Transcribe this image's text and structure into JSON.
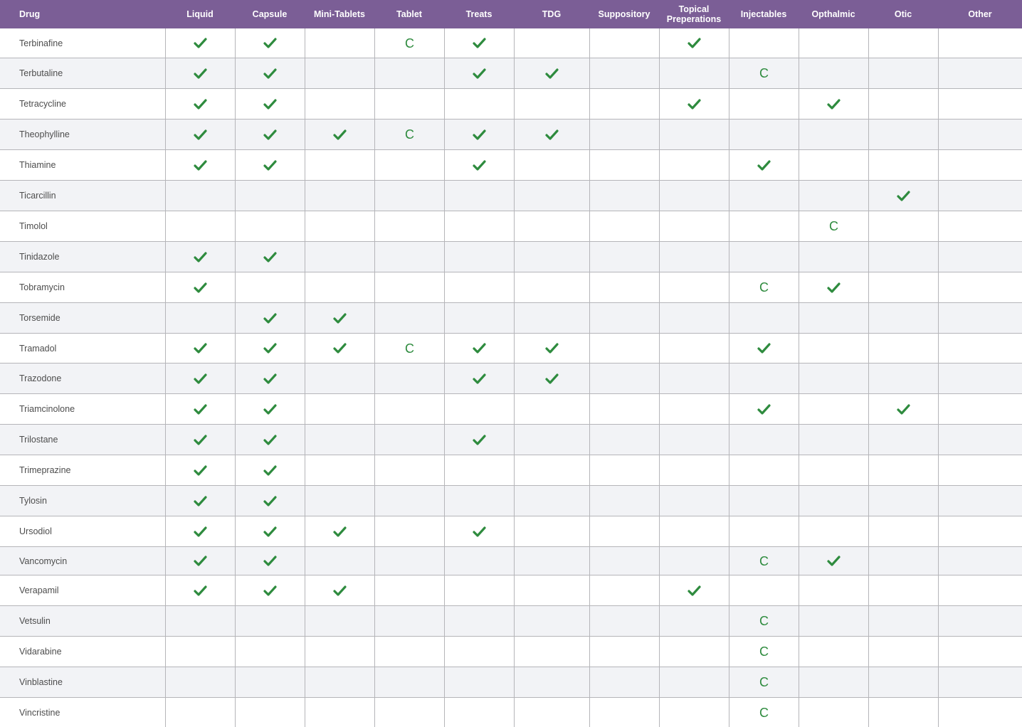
{
  "colors": {
    "header_bg": "#7b5e96",
    "check": "#2e8b3e",
    "stripe": "#f2f3f6",
    "grid": "#b5b5b9"
  },
  "legend_icons": {
    "check": "checkmark-icon",
    "compounded": "letter C"
  },
  "columns": [
    "Drug",
    "Liquid",
    "Capsule",
    "Mini-Tablets",
    "Tablet",
    "Treats",
    "TDG",
    "Suppository",
    "Topical Preperations",
    "Injectables",
    "Opthalmic",
    "Otic",
    "Other"
  ],
  "rows": [
    {
      "drug": "Terbinafine",
      "cells": [
        "check",
        "check",
        "",
        "C",
        "check",
        "",
        "",
        "check",
        "",
        "",
        "",
        ""
      ]
    },
    {
      "drug": "Terbutaline",
      "cells": [
        "check",
        "check",
        "",
        "",
        "check",
        "check",
        "",
        "",
        "C",
        "",
        "",
        ""
      ]
    },
    {
      "drug": "Tetracycline",
      "cells": [
        "check",
        "check",
        "",
        "",
        "",
        "",
        "",
        "check",
        "",
        "check",
        "",
        ""
      ]
    },
    {
      "drug": "Theophylline",
      "cells": [
        "check",
        "check",
        "check",
        "C",
        "check",
        "check",
        "",
        "",
        "",
        "",
        "",
        ""
      ]
    },
    {
      "drug": "Thiamine",
      "cells": [
        "check",
        "check",
        "",
        "",
        "check",
        "",
        "",
        "",
        "check",
        "",
        "",
        ""
      ]
    },
    {
      "drug": "Ticarcillin",
      "cells": [
        "",
        "",
        "",
        "",
        "",
        "",
        "",
        "",
        "",
        "",
        "check",
        ""
      ]
    },
    {
      "drug": "Timolol",
      "cells": [
        "",
        "",
        "",
        "",
        "",
        "",
        "",
        "",
        "",
        "C",
        "",
        ""
      ]
    },
    {
      "drug": "Tinidazole",
      "cells": [
        "check",
        "check",
        "",
        "",
        "",
        "",
        "",
        "",
        "",
        "",
        "",
        ""
      ]
    },
    {
      "drug": "Tobramycin",
      "cells": [
        "check",
        "",
        "",
        "",
        "",
        "",
        "",
        "",
        "C",
        "check",
        "",
        ""
      ]
    },
    {
      "drug": "Torsemide",
      "cells": [
        "",
        "check",
        "check",
        "",
        "",
        "",
        "",
        "",
        "",
        "",
        "",
        ""
      ]
    },
    {
      "drug": "Tramadol",
      "cells": [
        "check",
        "check",
        "check",
        "C",
        "check",
        "check",
        "",
        "",
        "check",
        "",
        "",
        ""
      ]
    },
    {
      "drug": "Trazodone",
      "cells": [
        "check",
        "check",
        "",
        "",
        "check",
        "check",
        "",
        "",
        "",
        "",
        "",
        ""
      ]
    },
    {
      "drug": "Triamcinolone",
      "cells": [
        "check",
        "check",
        "",
        "",
        "",
        "",
        "",
        "",
        "check",
        "",
        "check",
        ""
      ]
    },
    {
      "drug": "Trilostane",
      "cells": [
        "check",
        "check",
        "",
        "",
        "check",
        "",
        "",
        "",
        "",
        "",
        "",
        ""
      ]
    },
    {
      "drug": "Trimeprazine",
      "cells": [
        "check",
        "check",
        "",
        "",
        "",
        "",
        "",
        "",
        "",
        "",
        "",
        ""
      ]
    },
    {
      "drug": "Tylosin",
      "cells": [
        "check",
        "check",
        "",
        "",
        "",
        "",
        "",
        "",
        "",
        "",
        "",
        ""
      ]
    },
    {
      "drug": "Ursodiol",
      "cells": [
        "check",
        "check",
        "check",
        "",
        "check",
        "",
        "",
        "",
        "",
        "",
        "",
        ""
      ]
    },
    {
      "drug": "Vancomycin",
      "cells": [
        "check",
        "check",
        "",
        "",
        "",
        "",
        "",
        "",
        "C",
        "check",
        "",
        ""
      ]
    },
    {
      "drug": "Verapamil",
      "cells": [
        "check",
        "check",
        "check",
        "",
        "",
        "",
        "",
        "check",
        "",
        "",
        "",
        ""
      ]
    },
    {
      "drug": "Vetsulin",
      "cells": [
        "",
        "",
        "",
        "",
        "",
        "",
        "",
        "",
        "C",
        "",
        "",
        ""
      ]
    },
    {
      "drug": "Vidarabine",
      "cells": [
        "",
        "",
        "",
        "",
        "",
        "",
        "",
        "",
        "C",
        "",
        "",
        ""
      ]
    },
    {
      "drug": "Vinblastine",
      "cells": [
        "",
        "",
        "",
        "",
        "",
        "",
        "",
        "",
        "C",
        "",
        "",
        ""
      ]
    },
    {
      "drug": "Vincristine",
      "cells": [
        "",
        "",
        "",
        "",
        "",
        "",
        "",
        "",
        "C",
        "",
        "",
        ""
      ]
    }
  ]
}
